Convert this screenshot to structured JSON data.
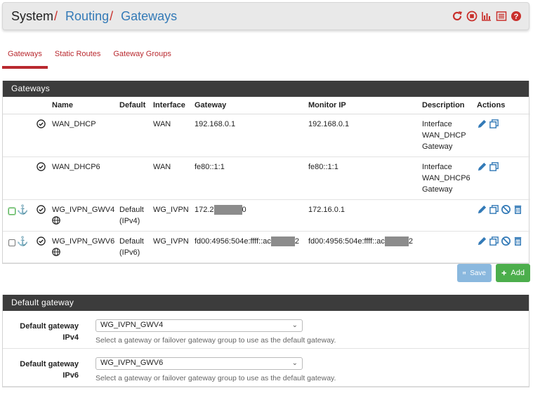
{
  "breadcrumb": {
    "root": "System",
    "routing": "Routing",
    "current": "Gateways"
  },
  "header_icons": [
    "reload-icon",
    "stop-icon",
    "chart-icon",
    "list-icon",
    "help-icon"
  ],
  "tabs": [
    {
      "label": "Gateways",
      "active": true
    },
    {
      "label": "Static Routes",
      "active": false
    },
    {
      "label": "Gateway Groups",
      "active": false
    }
  ],
  "gateways_panel": {
    "title": "Gateways",
    "columns": {
      "name": "Name",
      "default": "Default",
      "interface": "Interface",
      "gateway": "Gateway",
      "monitor": "Monitor IP",
      "description": "Description",
      "actions": "Actions"
    },
    "rows": [
      {
        "name": "WAN_DHCP",
        "default1": "",
        "default2": "",
        "interface": "WAN",
        "gateway": "192.168.0.1",
        "gateway_tail": "",
        "monitor": "192.168.0.1",
        "monitor_tail": "",
        "desc1": "Interface",
        "desc2": "WAN_DHCP",
        "desc3": "Gateway"
      },
      {
        "name": "WAN_DHCP6",
        "default1": "",
        "default2": "",
        "interface": "WAN",
        "gateway": "fe80::1:1",
        "gateway_tail": "",
        "monitor": "fe80::1:1",
        "monitor_tail": "",
        "desc1": "Interface",
        "desc2": "WAN_DHCP6",
        "desc3": "Gateway"
      },
      {
        "name": "WG_IVPN_GWV4",
        "default1": "Default",
        "default2": "(IPv4)",
        "interface": "WG_IVPN",
        "gateway": "172.2",
        "gateway_tail": "0",
        "monitor": "172.16.0.1",
        "monitor_tail": "",
        "desc1": "",
        "desc2": "",
        "desc3": ""
      },
      {
        "name": "WG_IVPN_GWV6",
        "default1": "Default",
        "default2": "(IPv6)",
        "interface": "WG_IVPN",
        "gateway": "fd00:4956:504e:ffff::ac",
        "gateway_tail": "2",
        "monitor": "fd00:4956:504e:ffff::ac",
        "monitor_tail": "2",
        "desc1": "",
        "desc2": "",
        "desc3": ""
      }
    ]
  },
  "buttons": {
    "save": "Save",
    "add": "Add"
  },
  "default_gateway_panel": {
    "title": "Default gateway",
    "ipv4_label_1": "Default gateway",
    "ipv4_label_2": "IPv4",
    "ipv4_value": "WG_IVPN_GWV4",
    "ipv6_label_1": "Default gateway",
    "ipv6_label_2": "IPv6",
    "ipv6_value": "WG_IVPN_GWV6",
    "help": "Select a gateway or failover gateway group to use as the default gateway."
  },
  "colors": {
    "header_bg": "#e9e9e9",
    "panel_head": "#3c3c3c",
    "accent_red": "#b9292f",
    "link_blue": "#337ab7",
    "add_green": "#4cae4c",
    "save_blue": "#8ab8de"
  }
}
